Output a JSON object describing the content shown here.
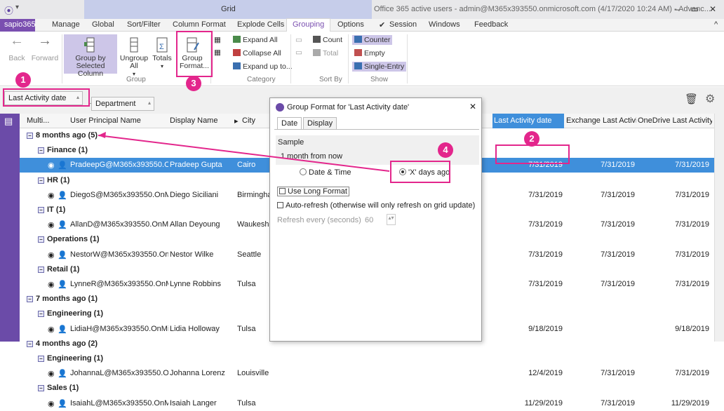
{
  "window": {
    "grid_tab": "Grid",
    "title": "Office 365 active users - admin@M365x393550.onmicrosoft.com (4/17/2020 10:24 AM) - Advanc...",
    "quick_access_icon": "app-logo-icon",
    "quick_access_dropdown": "▾",
    "minimize": "–",
    "maximize": "▭",
    "close": "✕"
  },
  "tabs": {
    "file": "sapio365",
    "items": [
      "Manage",
      "Global",
      "Sort/Filter",
      "Column Format",
      "Explode Cells",
      "Grouping",
      "Options",
      "Session",
      "Windows",
      "Feedback"
    ],
    "session_check": "✔",
    "collapse": "^"
  },
  "ribbon": {
    "back": "Back",
    "forward": "Forward",
    "group_by": "Group by\nSelected Column",
    "group_by_l1": "Group by",
    "group_by_l2": "Selected Column",
    "ungroup_l1": "Ungroup",
    "ungroup_l2": "All",
    "totals": "Totals",
    "group_format_l1": "Group",
    "group_format_l2": "Format...",
    "group_label": "Group",
    "expand_all": "Expand All",
    "collapse_all": "Collapse All",
    "expand_up_to": "Expand up to...",
    "category_label": "Category",
    "count": "Count",
    "total": "Total",
    "sortby_label": "Sort By",
    "counter": "Counter",
    "empty": "Empty",
    "single_entry": "Single-Entry",
    "show_label": "Show"
  },
  "grouppanel": {
    "chip1": "Last Activity date",
    "chip2": "Department",
    "chip_arrow": "▴"
  },
  "columns": {
    "multi": "Multi...",
    "upn": "User Principal Name",
    "display": "Display Name",
    "city": "City",
    "last_activity": "Last Activity date",
    "exchange": "Exchange Last Activity...",
    "onedrive": "OneDrive Last Activity..."
  },
  "rows": [
    {
      "type": "g1",
      "label": "8 months ago (5)"
    },
    {
      "type": "g2",
      "label": "Finance (1)"
    },
    {
      "type": "d",
      "upn": "PradeepG@M365x393550.OnMic",
      "name": "Pradeep Gupta",
      "city": "Cairo",
      "last": "7/31/2019",
      "exch": "7/31/2019",
      "od": "7/31/2019",
      "sel": true
    },
    {
      "type": "g2",
      "label": "HR (1)"
    },
    {
      "type": "d",
      "upn": "DiegoS@M365x393550.OnMicr",
      "name": "Diego Siciliani",
      "city": "Birmingham",
      "last": "7/31/2019",
      "exch": "7/31/2019",
      "od": "7/31/2019"
    },
    {
      "type": "g2",
      "label": "IT (1)"
    },
    {
      "type": "d",
      "upn": "AllanD@M365x393550.OnMicro",
      "name": "Allan Deyoung",
      "city": "Waukesha",
      "last": "7/31/2019",
      "exch": "7/31/2019",
      "od": "7/31/2019"
    },
    {
      "type": "g2",
      "label": "Operations (1)"
    },
    {
      "type": "d",
      "upn": "NestorW@M365x393550.OnMic",
      "name": "Nestor Wilke",
      "city": "Seattle",
      "last": "7/31/2019",
      "exch": "7/31/2019",
      "od": "7/31/2019"
    },
    {
      "type": "g2",
      "label": "Retail (1)"
    },
    {
      "type": "d",
      "upn": "LynneR@M365x393550.OnMicro",
      "name": "Lynne Robbins",
      "city": "Tulsa",
      "last": "7/31/2019",
      "exch": "7/31/2019",
      "od": "7/31/2019"
    },
    {
      "type": "g1",
      "label": "7 months ago (1)"
    },
    {
      "type": "g2",
      "label": "Engineering (1)"
    },
    {
      "type": "d",
      "upn": "LidiaH@M365x393550.OnMicros",
      "name": "Lidia Holloway",
      "city": "Tulsa",
      "last": "9/18/2019",
      "exch": "",
      "od": "9/18/2019"
    },
    {
      "type": "g1",
      "label": "4 months ago (2)"
    },
    {
      "type": "g2",
      "label": "Engineering (1)"
    },
    {
      "type": "d",
      "upn": "JohannaL@M365x393550.OnMic",
      "name": "Johanna Lorenz",
      "city": "Louisville",
      "last": "12/4/2019",
      "exch": "7/31/2019",
      "od": "7/31/2019"
    },
    {
      "type": "g2",
      "label": "Sales (1)"
    },
    {
      "type": "d",
      "upn": "IsaiahL@M365x393550.OnMicro",
      "name": "Isaiah Langer",
      "city": "Tulsa",
      "last": "11/29/2019",
      "exch": "7/31/2019",
      "od": "11/29/2019"
    }
  ],
  "dialog": {
    "title": "Group Format for 'Last Activity date'",
    "close": "✕",
    "tab_date": "Date",
    "tab_display": "Display",
    "sample_label": "Sample",
    "sample_value": "1 month from now",
    "radio_date": "Date & Time",
    "radio_days": "'X' days ago",
    "use_long": "Use Long Format",
    "auto_refresh": "Auto-refresh (otherwise will only refresh on grid update)",
    "refresh_every": "Refresh every (seconds)",
    "refresh_value": "60"
  },
  "callouts": [
    "1",
    "2",
    "3",
    "4"
  ],
  "colors": {
    "accent": "#6b4ba8",
    "callout": "#e3268c",
    "selection": "#3f8fdb"
  }
}
